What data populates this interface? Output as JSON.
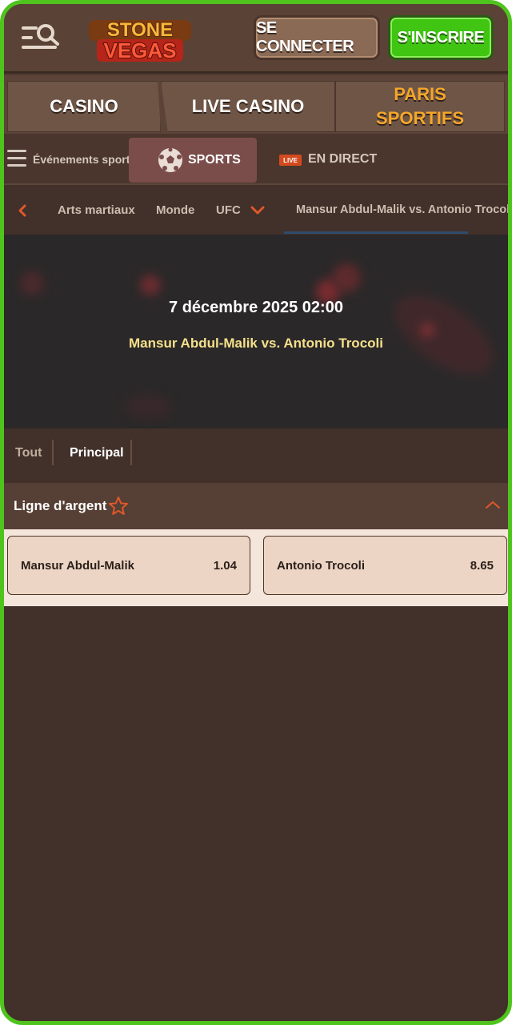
{
  "header": {
    "logo_line1": "STONE",
    "logo_line2": "VEGAS",
    "login_label": "SE CONNECTER",
    "register_label": "S'INSCRIRE"
  },
  "main_nav": {
    "tabs": [
      {
        "label": "CASINO"
      },
      {
        "label": "LIVE CASINO"
      },
      {
        "label": "PARIS SPORTIFS"
      }
    ]
  },
  "sports_bar": {
    "events_label": "Événements sportifs",
    "sports_label": "SPORTS",
    "live_badge": "LIVE",
    "live_label": "EN DIRECT"
  },
  "breadcrumb": {
    "items": [
      "Arts martiaux",
      "Monde",
      "UFC",
      "Mansur Abdul-Malik vs. Antonio Trocoli"
    ]
  },
  "event": {
    "date": "7 décembre 2025 02:00",
    "title": "Mansur Abdul-Malik vs. Antonio Trocoli"
  },
  "filters": {
    "tabs": [
      "Tout",
      "Principal"
    ]
  },
  "market": {
    "title": "Ligne d'argent",
    "outcomes": [
      {
        "name": "Mansur Abdul-Malik",
        "odds": "1.04"
      },
      {
        "name": "Antonio Trocoli",
        "odds": "8.65"
      }
    ]
  },
  "colors": {
    "frame": "#4fc41d",
    "accent_orange": "#f4a62a",
    "register_green": "#3fc512",
    "background": "#42302a"
  }
}
